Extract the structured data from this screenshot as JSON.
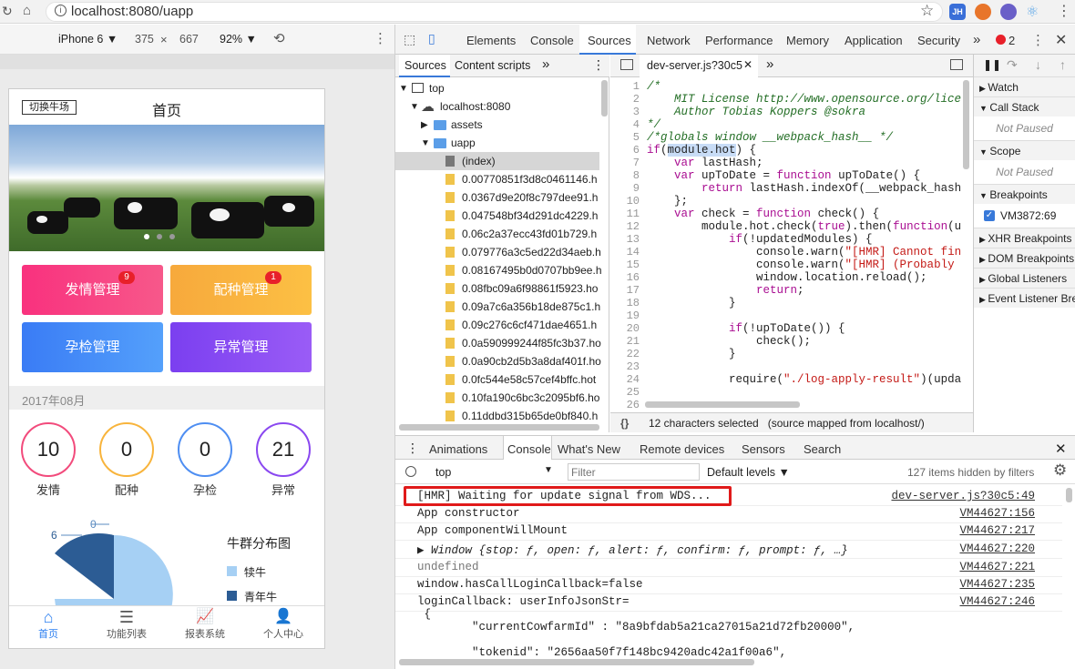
{
  "browser": {
    "url": "localhost:8080/uapp",
    "ext_labels": [
      "JH"
    ]
  },
  "device": {
    "model": "iPhone 6 ▼",
    "width": "375",
    "x": "×",
    "height": "667",
    "zoom": "92% ▼"
  },
  "phone": {
    "btn_switch": "切换牛场",
    "title": "首页",
    "tiles": [
      {
        "label": "发情管理",
        "badge": "9"
      },
      {
        "label": "配种管理",
        "badge": "1"
      },
      {
        "label": "孕检管理"
      },
      {
        "label": "异常管理"
      }
    ],
    "date": "2017年08月",
    "stats": [
      {
        "value": "10",
        "label": "发情"
      },
      {
        "value": "0",
        "label": "配种"
      },
      {
        "value": "0",
        "label": "孕检"
      },
      {
        "value": "21",
        "label": "异常"
      }
    ],
    "pie": {
      "title": "牛群分布图",
      "label_a": "6",
      "label_b": "0",
      "legend": [
        "犊牛",
        "青年牛"
      ]
    },
    "nav": [
      "首页",
      "功能列表",
      "报表系统",
      "个人中心"
    ]
  },
  "devtools": {
    "tabs": [
      "Elements",
      "Console",
      "Sources",
      "Network",
      "Performance",
      "Memory",
      "Application",
      "Security"
    ],
    "more": "»",
    "errors": "2",
    "nav_tabs": [
      "Sources",
      "Content scripts"
    ],
    "tree": {
      "top": "top",
      "host": "localhost:8080",
      "assets": "assets",
      "uapp": "uapp",
      "index": "(index)",
      "files": [
        "0.00770851f3d8c0461146.h",
        "0.0367d9e20f8c797dee91.h",
        "0.047548bf34d291dc4229.h",
        "0.06c2a37ecc43fd01b729.h",
        "0.079776a3c5ed22d34aeb.h",
        "0.08167495b0d0707bb9ee.h",
        "0.08fbc09a6f98861f5923.ho",
        "0.09a7c6a356b18de875c1.h",
        "0.09c276c6cf471dae4651.h",
        "0.0a590999244f85fc3b37.ho",
        "0.0a90cb2d5b3a8daf401f.ho",
        "0.0fc544e58c57cef4bffc.hot",
        "0.10fa190c6bc3c2095bf6.ho",
        "0.11ddbd315b65de0bf840.h"
      ]
    },
    "editor_tab": "dev-server.js?30c5",
    "code": [
      "/*",
      "    MIT License http://www.opensource.org/licens",
      "    Author Tobias Koppers @sokra",
      "*/",
      "/*globals window __webpack_hash__ */",
      "if(module.hot) {",
      "    var lastHash;",
      "    var upToDate = function upToDate() {",
      "        return lastHash.indexOf(__webpack_hash__",
      "    };",
      "    var check = function check() {",
      "        module.hot.check(true).then(function(upc",
      "            if(!updatedModules) {",
      "                console.warn(\"[HMR] Cannot find",
      "                console.warn(\"[HMR] (Probably be",
      "                window.location.reload();",
      "                return;",
      "            }",
      "",
      "            if(!upToDate()) {",
      "                check();",
      "            }",
      "",
      "            require(\"./log-apply-result\")(update",
      "",
      ""
    ],
    "status": "12 characters selected   (source mapped from localhost/)",
    "status_icon": "{}",
    "side": {
      "watch": "Watch",
      "callstack": "Call Stack",
      "notpaused": "Not Paused",
      "scope": "Scope",
      "breakpoints": "Breakpoints",
      "bp_item": "VM3872:69",
      "xhr": "XHR Breakpoints",
      "dom": "DOM Breakpoints",
      "global": "Global Listeners",
      "event": "Event Listener Bre"
    },
    "drawer_tabs": [
      "Animations",
      "Console",
      "What's New",
      "Remote devices",
      "Sensors",
      "Search"
    ],
    "console_context": "top",
    "filter_placeholder": "Filter",
    "levels": "Default levels ▼",
    "hidden": "127 items hidden by filters",
    "logs": [
      {
        "text": "[HMR] Waiting for update signal from WDS...",
        "src": "dev-server.js?30c5:49"
      },
      {
        "text": "App constructor",
        "src": "VM44627:156"
      },
      {
        "text": "App componentWillMount",
        "src": "VM44627:217"
      },
      {
        "text": "Window {stop: ƒ, open: ƒ, alert: ƒ, confirm: ƒ, prompt: ƒ, …}",
        "src": "VM44627:220"
      },
      {
        "text": "undefined",
        "src": "VM44627:221"
      },
      {
        "text": "window.hasCallLoginCallback=false",
        "src": "VM44627:235"
      },
      {
        "text": "loginCallback: userInfoJsonStr=",
        "src": "VM44627:246"
      },
      {
        "text": " {",
        "src": ""
      },
      {
        "text": "        \"currentCowfarmId\" : \"8a9bfdab5a21ca27015a21d72fb20000\",",
        "src": ""
      },
      {
        "text": "        \"tokenid\": \"2656aa50f7f148bc9420adc42a1f00a6\",",
        "src": ""
      }
    ]
  }
}
